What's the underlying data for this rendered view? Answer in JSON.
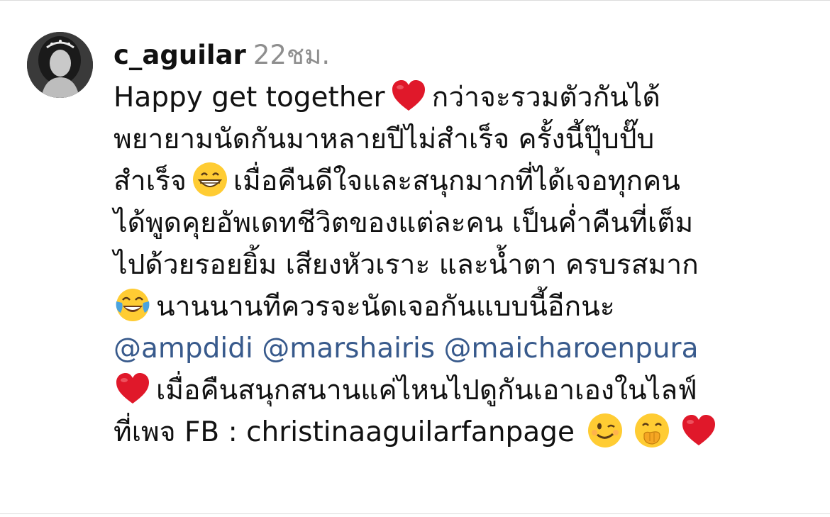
{
  "comment": {
    "username": "c_aguilar",
    "time": "22ชม.",
    "line1_a": "Happy get together",
    "line1_b": "กว่าจะรวมตัวกันได้",
    "line2": "พยายามนัดกันมาหลายปีไม่สำเร็จ ครั้งนี้ปุ๊บปั๊บ",
    "line3_a": "สำเร็จ",
    "line3_b": "เมื่อคืนดีใจและสนุกมากที่ได้เจอทุกคน",
    "line4": "ได้พูดคุยอัพเดทชีวิตของแต่ละคน เป็นค่ำคืนที่เต็ม",
    "line5": "ไปด้วยรอยยิ้ม เสียงหัวเราะ และน้ำตา ครบรสมาก",
    "line6": "นานนานทีควรจะนัดเจอกันแบบนี้อีกนะ",
    "mention1": "@ampdidi",
    "mention2": "@marshairis",
    "mention3": "@maicharoenpura",
    "line8": "เมื่อคืนสนุกสนานแค่ไหนไปดูกันเอาเองในไลฟ์",
    "line9": "ที่เพจ FB : christinaaguilarfanpage"
  },
  "icons": {
    "heart": "red-heart-icon",
    "grin": "grinning-face-icon",
    "tears_of_joy": "face-with-tears-of-joy-icon",
    "wink": "winking-face-icon",
    "hand_over_mouth": "face-with-hand-over-mouth-icon"
  },
  "colors": {
    "username": "#111111",
    "time": "#8e8e8e",
    "mention": "#385a8c",
    "heart": "#e0182a",
    "emoji_face": "#ffcc33"
  }
}
